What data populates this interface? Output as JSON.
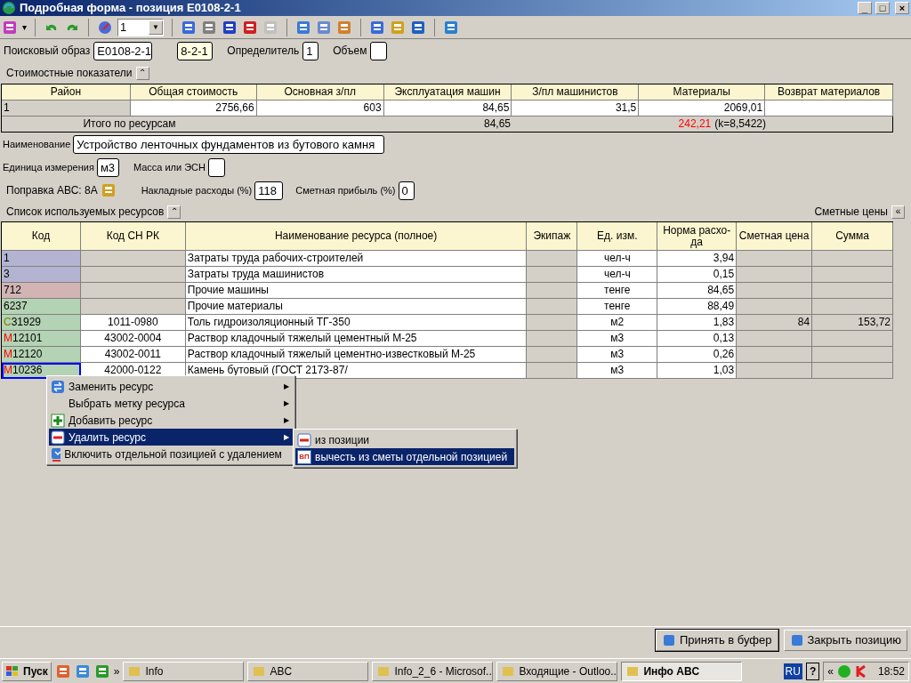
{
  "window": {
    "title": "Подробная форма - позиция Е0108-2-1",
    "controls": [
      "_",
      "□",
      "×"
    ]
  },
  "toolbar": {
    "combo_value": "1",
    "combo_arrow": "▼",
    "menu_arrow": "▾"
  },
  "search": {
    "label": "Поисковый образ",
    "value": "Е0108-2-1",
    "code": "8-2-1",
    "determinant_label": "Определитель",
    "determinant": "1",
    "volume_label": "Объем"
  },
  "cost": {
    "title": "Стоимостные показатели",
    "collapse": "⌃",
    "columns": [
      "Район",
      "Общая стоимость",
      "Основная з/пл",
      "Эксплуатация машин",
      "З/пл машинистов",
      "Материалы",
      "Возврат материалов"
    ],
    "row": [
      "1",
      "2756,66",
      "603",
      "84,65",
      "31,5",
      "2069,01"
    ],
    "total_label": "Итого по ресурсам",
    "total_machines": "84,65",
    "total_materials": "242,21",
    "k": "(k=8,5422)"
  },
  "fields": {
    "name_label": "Наименование",
    "name": "Устройство ленточных фундаментов из бутового камня",
    "unit_label": "Единица измерения",
    "unit": "м3",
    "mass_label": "Масса или ЭСН",
    "correction": "Поправка АВС: 8А",
    "overhead_label": "Накладные расходы (%)",
    "overhead": "118",
    "profit_label": "Сметная прибыль (%)",
    "profit": "0"
  },
  "resources": {
    "title": "Список используемых ресурсов",
    "collapse": "⌃",
    "prices_label": "Сметные цены",
    "prices_toggle": "«",
    "columns": [
      "Код",
      "Код СН РК",
      "Наименование ресурса (полное)",
      "Экипаж",
      "Ед. изм.",
      "Норма расхо-да",
      "Сметная цена",
      "Сумма"
    ],
    "rows": [
      {
        "code": "1",
        "color": "#b4b4d2",
        "name": "Затраты труда рабочих-строителей",
        "unit": "чел-ч",
        "norm": "3,94",
        "selected": false
      },
      {
        "code": "3",
        "color": "#b4b4d2",
        "name": "Затраты труда машинистов",
        "unit": "чел-ч",
        "norm": "0,15",
        "selected": false
      },
      {
        "code": "712",
        "color": "#d2b4b4",
        "name": "Прочие машины",
        "unit": "тенге",
        "norm": "84,65",
        "selected": false
      },
      {
        "code": "6237",
        "color": "#b4d2b4",
        "name": "Прочие материалы",
        "unit": "тенге",
        "norm": "88,49",
        "selected": false
      },
      {
        "prefix": {
          "text": "С",
          "color": "#808000"
        },
        "code": "31929",
        "color": "#b4d2b4",
        "sn": "1011-0980",
        "name": "Толь гидроизоляционный ТГ-350",
        "unit": "м2",
        "norm": "1,83",
        "price": "84",
        "sum": "153,72",
        "selected": false
      },
      {
        "prefix": {
          "text": "М",
          "color": "#ff0000"
        },
        "code": "12101",
        "color": "#b4d2b4",
        "sn": "43002-0004",
        "name": "Раствор кладочный тяжелый цементный М-25",
        "unit": "м3",
        "norm": "0,13",
        "selected": false
      },
      {
        "prefix": {
          "text": "М",
          "color": "#ff0000"
        },
        "code": "12120",
        "color": "#b4d2b4",
        "sn": "43002-0011",
        "name": "Раствор кладочный тяжелый цементно-известковый М-25",
        "unit": "м3",
        "norm": "0,26",
        "selected": false
      },
      {
        "prefix": {
          "text": "М",
          "color": "#ff0000"
        },
        "code": "10236",
        "color": "#b4d2b4",
        "sn": "42000-0122",
        "name": "Камень бутовый (ГОСТ 2173-87/",
        "unit": "м3",
        "norm": "1,03",
        "selected": true
      }
    ]
  },
  "context_menu": {
    "items": [
      {
        "label": "Заменить ресурс",
        "kind": "swap",
        "submenu": true,
        "selected": false
      },
      {
        "label": "Выбрать метку ресурса",
        "kind": "plain",
        "submenu": true,
        "selected": false
      },
      {
        "label": "Добавить ресурс",
        "kind": "add",
        "submenu": true,
        "selected": false
      },
      {
        "label": "Удалить ресурс",
        "kind": "remove",
        "submenu": true,
        "selected": true
      },
      {
        "label": "Включить отдельной позицией с удалением",
        "kind": "include",
        "submenu": false,
        "selected": false
      }
    ],
    "arrow": "▶",
    "submenu": [
      {
        "label": "из позиции",
        "kind": "remove",
        "selected": false
      },
      {
        "label": "вычесть из сметы отдельной позицией",
        "kind": "badge",
        "badge": "ВП",
        "selected": true
      }
    ]
  },
  "buttons": [
    "Принять в буфер",
    "Закрыть позицию"
  ],
  "taskbar": {
    "start": "Пуск",
    "more": "»",
    "tasks": [
      {
        "label": "Info",
        "selected": false
      },
      {
        "label": "ABC",
        "selected": false
      },
      {
        "label": "Info_2_6 - Microsof...",
        "selected": false
      },
      {
        "label": "Входящие - Outloo...",
        "selected": false
      },
      {
        "label": "Инфо ABC",
        "selected": true
      }
    ],
    "lang": "RU",
    "help": "?",
    "tray_more": "«",
    "time": "18:52"
  }
}
